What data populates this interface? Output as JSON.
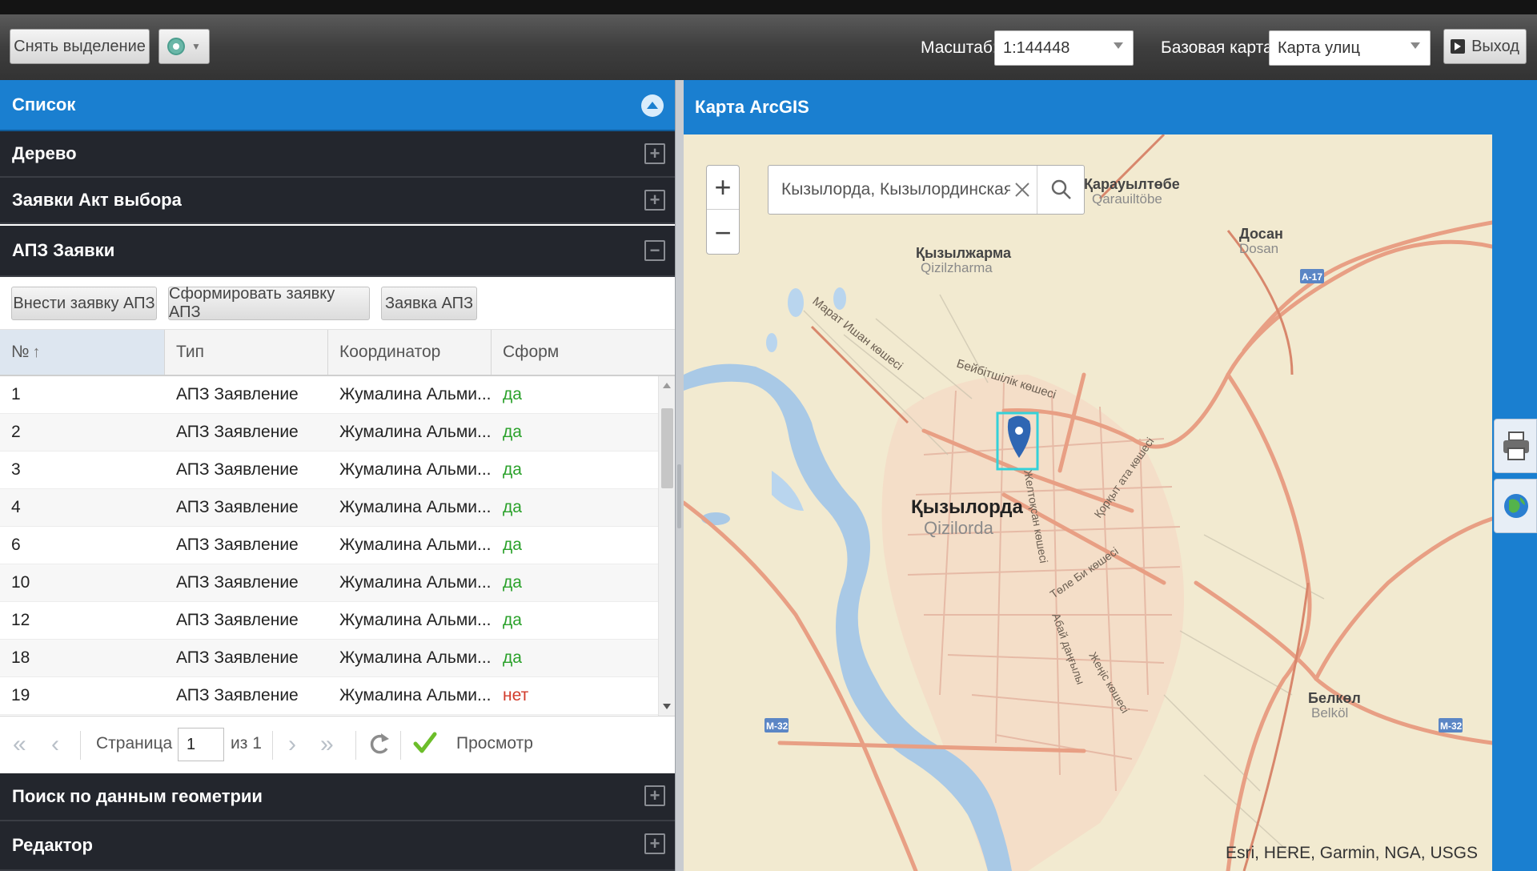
{
  "toolbar": {
    "deselect_label": "Снять выделение",
    "scale_label": "Масштаб:",
    "scale_value": "1:144448",
    "basemap_label": "Базовая карта:",
    "basemap_value": "Карта улиц",
    "exit_label": "Выход",
    "locate_icon": "location-pin-icon"
  },
  "left_panel": {
    "sections": {
      "list": "Список",
      "tree": "Дерево",
      "akt": "Заявки Акт выбора",
      "apz": "АПЗ Заявки",
      "geometry": "Поиск по данным геометрии",
      "editor": "Редактор"
    },
    "apz_buttons": {
      "add": "Внести заявку АПЗ",
      "form": "Сформировать заявку АПЗ",
      "request": "Заявка АПЗ"
    },
    "columns": {
      "num": "№",
      "type": "Тип",
      "coord": "Координатор",
      "form": "Сформ"
    },
    "rows": [
      {
        "num": "1",
        "type": "АПЗ Заявление",
        "coord": "Жумалина Альми...",
        "form": "да"
      },
      {
        "num": "2",
        "type": "АПЗ Заявление",
        "coord": "Жумалина Альми...",
        "form": "да"
      },
      {
        "num": "3",
        "type": "АПЗ Заявление",
        "coord": "Жумалина Альми...",
        "form": "да"
      },
      {
        "num": "4",
        "type": "АПЗ Заявление",
        "coord": "Жумалина Альми...",
        "form": "да"
      },
      {
        "num": "6",
        "type": "АПЗ Заявление",
        "coord": "Жумалина Альми...",
        "form": "да"
      },
      {
        "num": "10",
        "type": "АПЗ Заявление",
        "coord": "Жумалина Альми...",
        "form": "да"
      },
      {
        "num": "12",
        "type": "АПЗ Заявление",
        "coord": "Жумалина Альми...",
        "form": "да"
      },
      {
        "num": "18",
        "type": "АПЗ Заявление",
        "coord": "Жумалина Альми...",
        "form": "да"
      },
      {
        "num": "19",
        "type": "АПЗ Заявление",
        "coord": "Жумалина Альми...",
        "form": "нет"
      }
    ],
    "pager": {
      "page_label": "Страница",
      "page_value": "1",
      "of_label": "из 1",
      "view_label": "Просмотр"
    }
  },
  "map": {
    "title": "Карта ArcGIS",
    "search_value": "Кызылорда, Кызылординская обл.",
    "attribution": "Esri, HERE, Garmin, NGA, USGS",
    "labels": {
      "karauyl_kz": "Қарауылтөбе",
      "karauyl_lat": "Qarauiltöbe",
      "dosan_kz": "Досан",
      "dosan_lat": "Dosan",
      "kyzyl_kz": "Қызылжарма",
      "kyzyl_lat": "Qizilzharma",
      "city_kz": "Қызылорда",
      "city_lat": "Qizilorda",
      "belkol_kz": "Белкөл",
      "belkol_lat": "Belköl",
      "road_a17": "A-17",
      "road_m32a": "M-32",
      "road_m32b": "M-32",
      "street1": "Марат Ишан көшесі",
      "street2": "Бейбітшілік көшесі",
      "street3": "Қорқыт ата көшесі",
      "street4": "Желтоқсан көшесі",
      "street5": "Төле Би көшесі",
      "street6": "Абай даңғылы",
      "street7": "Жеңіс көшесі"
    }
  },
  "colors": {
    "accent": "#1a7fd0",
    "panel_dark": "#23262d",
    "yes": "#2aa12a",
    "no": "#d23b2b"
  }
}
